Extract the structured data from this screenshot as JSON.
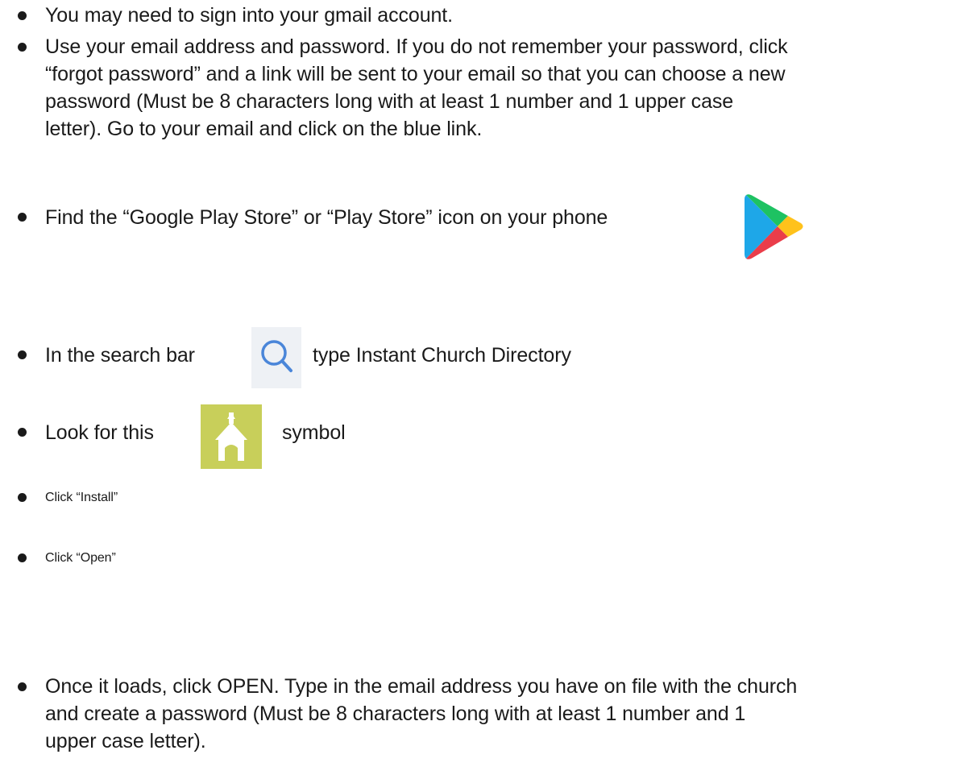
{
  "steps": [
    {
      "lines": [
        "You may need to sign into your gmail account."
      ]
    },
    {
      "lines": [
        "Use your email address and password. If you do not remember your password, click",
        "“forgot password” and a link will be sent to your email so that you can choose a new",
        "password (Must be 8 characters long with at least 1 number and 1 upper case",
        "letter). Go to your email and click on the blue link."
      ]
    },
    {
      "text": "Find the “Google Play Store” or “Play Store” icon on your phone",
      "icon": "google-play-store-icon"
    },
    {
      "before": "In the search bar",
      "after": "type Instant Church Directory",
      "icon": "magnifier-search-icon"
    },
    {
      "before": "Look for this",
      "after": "symbol",
      "icon": "church-directory-app-icon"
    },
    {
      "text": "Click “Install”"
    },
    {
      "text": "Click “Open”"
    },
    {
      "lines": [
        "Once it loads, click OPEN. Type in the email address you have on file with the church",
        "and create a password (Must be 8 characters long with at least 1 number and 1",
        "upper case letter)."
      ]
    }
  ],
  "colors": {
    "text": "#1a1a1a",
    "church_icon_bg": "#c8cf5a",
    "search_icon_bg": "#eef1f5",
    "search_icon_stroke": "#4a86d9"
  }
}
